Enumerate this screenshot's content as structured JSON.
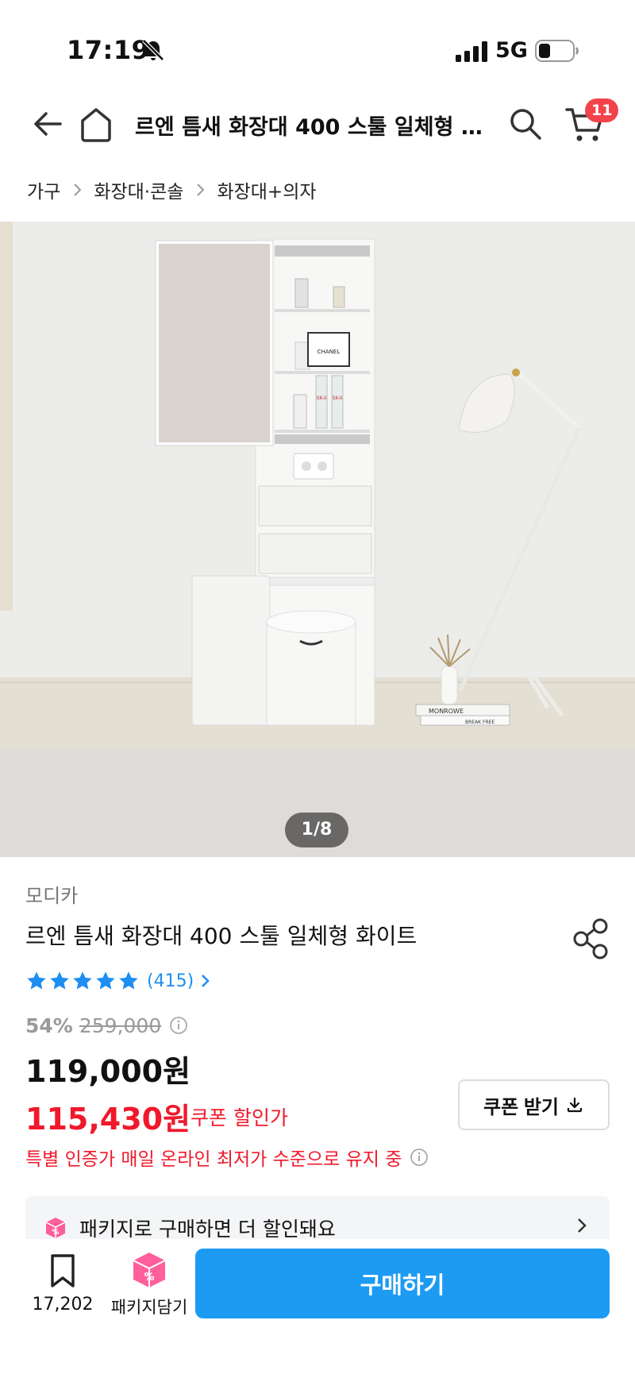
{
  "status_bar": {
    "time": "17:19",
    "network": "5G"
  },
  "nav": {
    "title": "르엔 틈새 화장대 400 스툴 일체형 화이트",
    "cart_count": "11"
  },
  "breadcrumb": [
    "가구",
    "화장대·콘솔",
    "화장대+의자"
  ],
  "hero": {
    "image_counter": "1/8",
    "text": {
      "chanel": "CHANEL",
      "sk1": "SK-II",
      "sk2": "SK-II",
      "book1": "MONROWE",
      "book2": "BREAK FREE"
    }
  },
  "product": {
    "brand": "모디카",
    "name": "르엔 틈새 화장대 400 스툴 일체형 화이트",
    "rating_stars": 5,
    "review_count": "(415)",
    "discount_rate": "54%",
    "original_price": "259,000",
    "sale_price": "119,000원",
    "coupon_price": "115,430원",
    "coupon_label": "쿠폰 할인가",
    "coupon_button": "쿠폰 받기",
    "lowest_notice": "특별 인증가 매일 온라인 최저가 수준으로 유지 중"
  },
  "package_banner": {
    "text": "패키지로 구매하면 더 할인돼요"
  },
  "bottom_bar": {
    "wish_count": "17,202",
    "package_label": "패키지담기",
    "buy_label": "구매하기"
  },
  "colors": {
    "accent_blue": "#1d9bf3",
    "price_red": "#f0192b",
    "badge_red": "#f2434b",
    "star_blue": "#1f8ef1",
    "package_pink": "#ff5f9a"
  },
  "icons": [
    "bell-slash-icon",
    "signal-icon",
    "battery-icon",
    "back-arrow-icon",
    "home-icon",
    "search-icon",
    "cart-icon",
    "chevron-right-icon",
    "share-icon",
    "star-icon",
    "info-icon",
    "download-icon",
    "package-icon",
    "bookmark-icon"
  ]
}
